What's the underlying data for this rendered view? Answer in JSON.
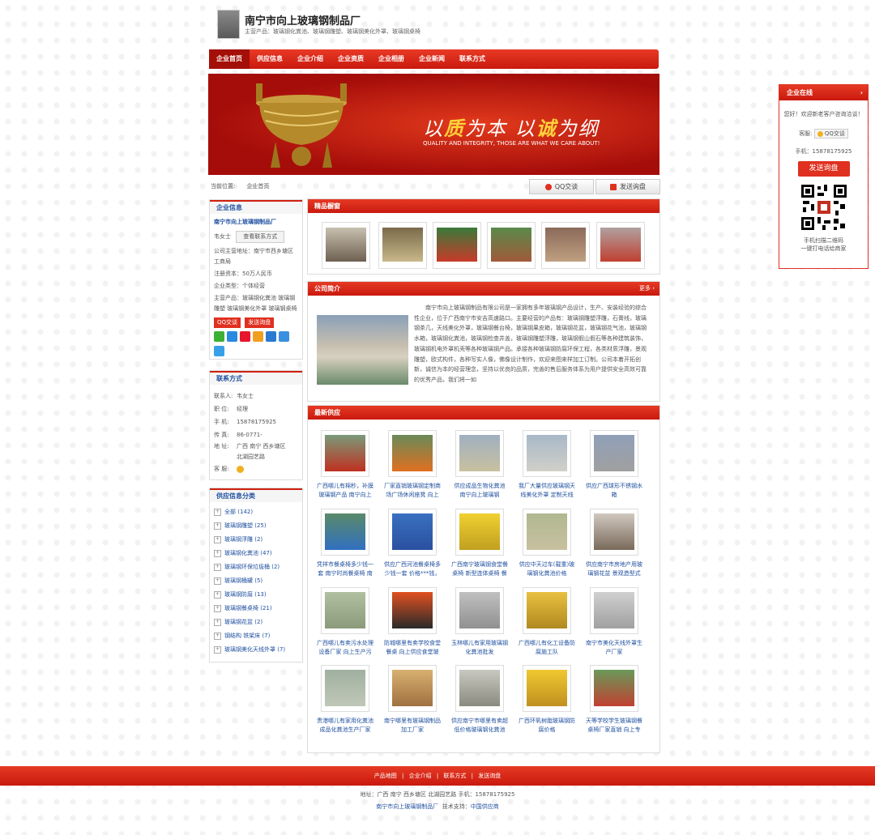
{
  "header": {
    "company_name": "南宁市向上玻璃钢制品厂",
    "main_products": "主营产品：玻璃钢化粪池、玻璃钢雕塑、玻璃钢美化外罩、玻璃钢桌椅"
  },
  "nav": [
    "企业首页",
    "供应信息",
    "企业介绍",
    "企业资质",
    "企业相册",
    "企业新闻",
    "联系方式"
  ],
  "banner": {
    "slogan_a1": "以",
    "slogan_a2": "质",
    "slogan_a3": "为本 以",
    "slogan_a4": "诚",
    "slogan_a5": "为纲",
    "slogan_en": "QUALITY AND INTEGRITY, THOSE ARE WHAT WE CARE ABOUT!"
  },
  "breadcrumb": {
    "label": "当前位置:",
    "current": "企业首页"
  },
  "actions": {
    "qq": "QQ交谈",
    "inquiry": "发送询盘"
  },
  "company_info": {
    "title": "企业信息",
    "name": "南宁市向上玻璃钢制品厂",
    "contact_person": "韦女士",
    "view_contact": "查看联系方式",
    "address": "公司主营地址：南宁市西乡塘区工商局",
    "capital": "注册资本：50万人民币",
    "nature": "企业类型：个体经营",
    "products": "主营产品：玻璃钢化粪池 玻璃钢雕塑 玻璃钢美化外罩 玻璃钢桌椅",
    "qq_btn": "QQ交谈",
    "inquiry_btn": "发送询盘"
  },
  "contact": {
    "title": "联系方式",
    "rows": [
      {
        "k": "联系人:",
        "v": "韦女士"
      },
      {
        "k": "职 位:",
        "v": "经理"
      },
      {
        "k": "手 机:",
        "v": "15878175925"
      },
      {
        "k": "传 真:",
        "v": "86-0771-"
      },
      {
        "k": "地 址:",
        "v": "广西 南宁 西乡塘区"
      },
      {
        "k": "",
        "v": "北湖园艺路"
      },
      {
        "k": "客 服:",
        "v": ""
      }
    ]
  },
  "categories": {
    "title": "供应信息分类",
    "items": [
      "全部 (142)",
      "玻璃钢雕塑 (25)",
      "玻璃钢浮雕 (2)",
      "玻璃钢化粪池 (47)",
      "玻璃钢环保垃圾桶 (2)",
      "玻璃钢桶罐 (5)",
      "玻璃钢防腐 (13)",
      "玻璃钢餐桌椅 (21)",
      "玻璃钢花盆 (2)",
      "钢结构 铁架床 (7)",
      "玻璃钢美化天线外罩 (7)"
    ]
  },
  "featured": {
    "title": "精品橱窗"
  },
  "intro": {
    "title": "公司简介",
    "more": "更多 ›",
    "text": "南宁市向上玻璃钢制品有限公司是一家拥有多年玻璃钢产品设计，生产、安装经验的综合性企业，位于广西南宁市安吉高速路口。主要经营的产品有：玻璃钢雕塑浮雕，石膏线，玻璃钢茶几，天线美化外罩，玻璃钢餐台椅，玻璃钢果皮箱，玻璃钢花盆，玻璃钢花气池，玻璃钢水箱，玻璃钢化粪池，玻璃钢检查井盖，玻璃钢雕塑浮雕，玻璃钢假山假石等各种建筑装饰，玻璃钢机电外罩机壳等各种玻璃钢产品。承接各种玻璃钢防腐环保工程，各类材质浮雕，景观雕塑，欧式构件，各种写实人像，佛像设计制作，欢迎来图来样加工订制。公司本着开拓创新，诚信为本的经营理念，坚持以优良的品质，完善的售后服务体系为用户提供安全高效可靠的优秀产品，我们将一如"
  },
  "latest": {
    "title": "最新供应",
    "items": [
      "广西哪儿有棉秒，补膜玻璃钢产品 南宁向上玻璃",
      "厂家直销玻璃钢定制商场广场休闲座凳 向上玻璃",
      "供应成品生物化粪池 南宁向上玻璃钢",
      "我厂大量供应玻璃钢天线美化外罩 定制天线外罩",
      "供应广西球形不锈钢水箱",
      "凭祥市餐桌椅多少钱一套 南宁时尚餐桌椅 南宁向",
      "供应广西河池餐桌椅多少钱一套 价格***钱，质量",
      "广西南宁玻璃钢食堂餐桌椅 新型连体桌椅 餐厅餐",
      "供应中天过车(载重)玻璃钢化粪池价格",
      "供应南宁市房地产用玻璃钢花盆 景观造型式花盆",
      "广西哪儿有卖污水处理设备厂家 向上生产污水设",
      "防城哪里有卖学校食堂餐桌 向上供应食堂玻璃",
      "玉林哪儿有家用玻璃钢化粪池批发",
      "广西哪儿有化工设备防腐施工队",
      "南宁市美化天线外罩生产厂家",
      "贵港哪儿有家用化粪池成品化粪池生产厂家 向",
      "南宁哪里有玻璃钢制品加工厂家",
      "供应南宁市哪里有卖超低价格玻璃钢化粪池",
      "广西环氧树脂玻璃钢防腐价格",
      "天等学校学生玻璃钢餐桌椅厂家直销 向上专供可"
    ]
  },
  "online": {
    "title": "企业在线",
    "arrow": "›",
    "welcome": "您好！欢迎新老客户咨询洽谈！",
    "service_label": "客服:",
    "qq": "QQ交谈",
    "phone": "手机：15878175925",
    "inquiry": "发送询盘",
    "qr_text1": "手机扫描二维码",
    "qr_text2": "一键打电话给商家"
  },
  "footer": {
    "links": [
      "产品地图",
      "企业介绍",
      "联系方式",
      "发送询盘"
    ],
    "line1": "地址：广西 南宁 西乡塘区 北湖园艺路 手机：15878175925",
    "company": "南宁市向上玻璃钢制品厂",
    "support_label": "技术支持：",
    "support": "中国供应商"
  },
  "colors": {
    "accent": "#d8251a",
    "link": "#2050a0"
  }
}
